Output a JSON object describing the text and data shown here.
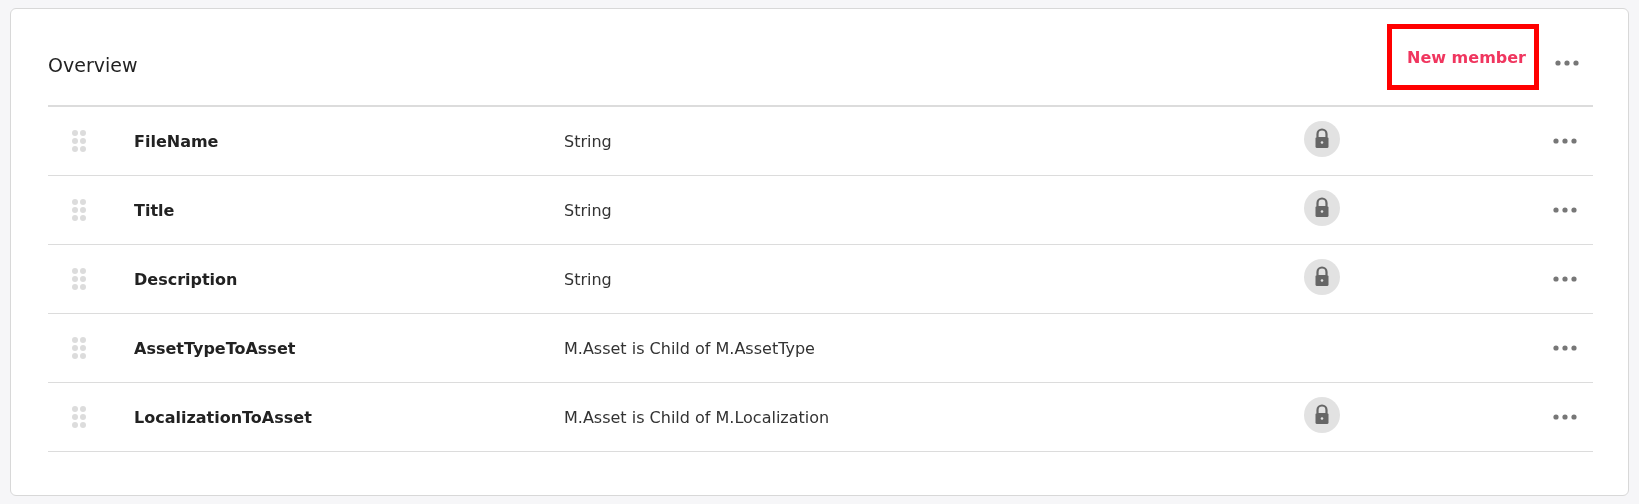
{
  "title": "Overview",
  "new_member_button": {
    "label": "New member",
    "highlighted": true
  },
  "members": [
    {
      "name": "FileName",
      "type": "String",
      "locked": true
    },
    {
      "name": "Title",
      "type": "String",
      "locked": true
    },
    {
      "name": "Description",
      "type": "String",
      "locked": true
    },
    {
      "name": "AssetTypeToAsset",
      "type": "M.Asset is Child of M.AssetType",
      "locked": false
    },
    {
      "name": "LocalizationToAsset",
      "type": "M.Asset is Child of M.Localization",
      "locked": true
    }
  ]
}
